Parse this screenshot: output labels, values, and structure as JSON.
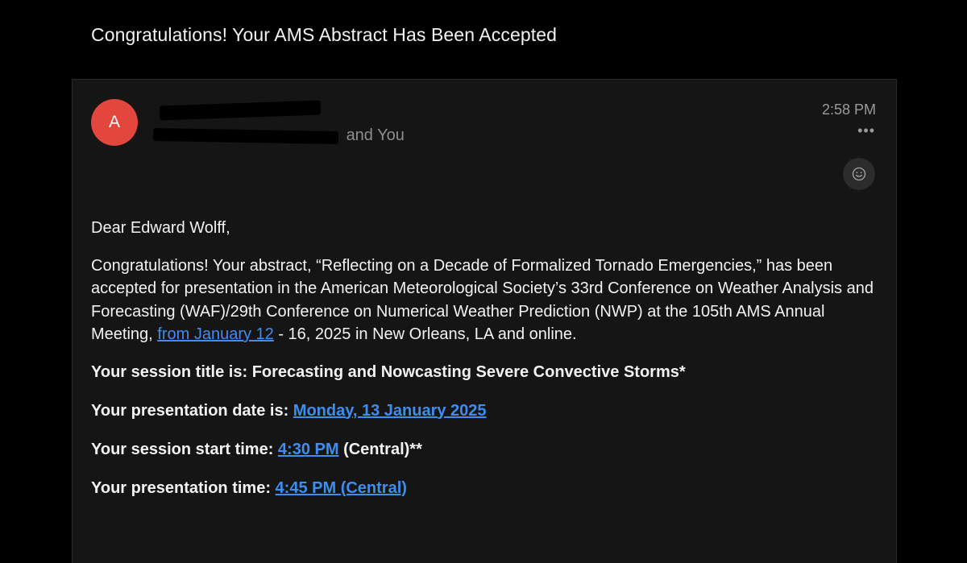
{
  "email": {
    "subject": "Congratulations! Your AMS Abstract Has Been Accepted",
    "avatar_letter": "A",
    "recipient_suffix": "and You",
    "time": "2:58 PM",
    "more_icon": "•••",
    "reaction_icon": "smiley-icon"
  },
  "body": {
    "greeting": "Dear Edward Wolff,",
    "para_part1": "Congratulations! Your abstract, “Reflecting on a Decade of Formalized Tornado Emergencies,” has been accepted for presentation in the American Meteorological Society’s 33rd Conference on Weather Analysis and Forecasting (WAF)/29th Conference on Numerical Weather Prediction (NWP) at the 105th AMS Annual Meeting, ",
    "para_link": "from January 12",
    "para_part2": " - 16, 2025 in New Orleans, LA and online.",
    "session_title_label": "Your session title is: ",
    "session_title_value": "Forecasting and Nowcasting Severe Convective Storms*",
    "presentation_date_label": "Your presentation date is: ",
    "presentation_date_value": "Monday, 13 January 2025",
    "session_start_label": "Your session start time: ",
    "session_start_value": "4:30 PM",
    "session_start_suffix": " (Central)**",
    "presentation_time_label": "Your presentation time: ",
    "presentation_time_value": "4:45 PM (Central)"
  },
  "colors": {
    "avatar": "#e2463c",
    "link": "#3d8ef0",
    "background": "#000000",
    "card": "#151515"
  }
}
